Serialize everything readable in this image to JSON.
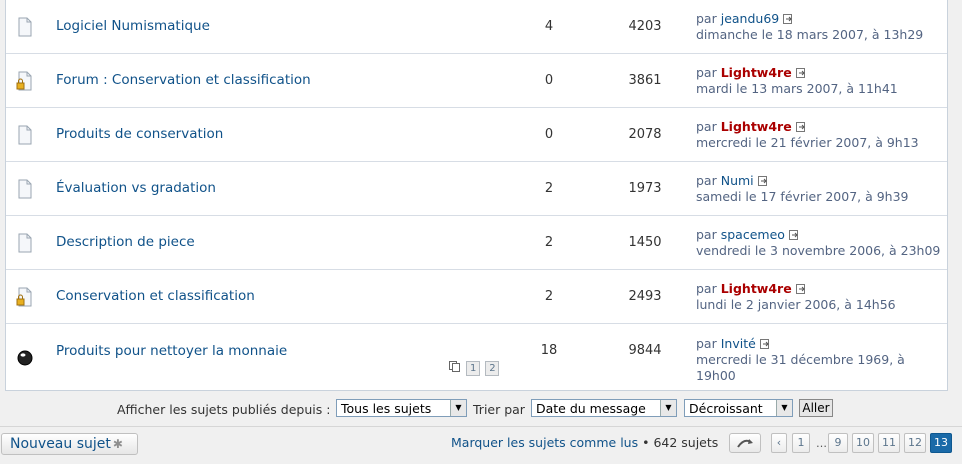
{
  "topics": [
    {
      "title": "Logiciel Numismatique",
      "replies": "4",
      "views": "4203",
      "by": "par ",
      "author": "jeandu69",
      "author_admin": false,
      "date": "dimanche le 18 mars 2007, à 13h29",
      "icon": "topic-read-icon"
    },
    {
      "title": "Forum : Conservation et classification",
      "replies": "0",
      "views": "3861",
      "by": "par ",
      "author": "Lightw4re",
      "author_admin": true,
      "date": "mardi le 13 mars 2007, à 11h41",
      "icon": "topic-locked-icon"
    },
    {
      "title": "Produits de conservation",
      "replies": "0",
      "views": "2078",
      "by": "par ",
      "author": "Lightw4re",
      "author_admin": true,
      "date": "mercredi le 21 février 2007, à 9h13",
      "icon": "topic-read-icon"
    },
    {
      "title": "Évaluation vs gradation",
      "replies": "2",
      "views": "1973",
      "by": "par ",
      "author": "Numi",
      "author_admin": false,
      "date": "samedi le 17 février 2007, à 9h39",
      "icon": "topic-read-icon"
    },
    {
      "title": "Description de piece",
      "replies": "2",
      "views": "1450",
      "by": "par ",
      "author": "spacemeo",
      "author_admin": false,
      "date": "vendredi le 3 novembre 2006, à 23h09",
      "icon": "topic-read-icon"
    },
    {
      "title": "Conservation et classification",
      "replies": "2",
      "views": "2493",
      "by": "par ",
      "author": "Lightw4re",
      "author_admin": true,
      "date": "lundi le 2 janvier 2006, à 14h56",
      "icon": "topic-locked-icon"
    },
    {
      "title": "Produits pour nettoyer la monnaie",
      "replies": "18",
      "views": "9844",
      "by": "par ",
      "author": "Invité",
      "author_admin": false,
      "date_line1": "mercredi le 31 décembre 1969, à",
      "date_line2": "19h00",
      "icon": "topic-global-icon",
      "pages": [
        "1",
        "2"
      ]
    }
  ],
  "filter": {
    "label": "Afficher les sujets publiés depuis :",
    "days_value": "Tous les sujets",
    "sort_label": "Trier par",
    "sort_key_value": "Date du message",
    "sort_dir_value": "Décroissant",
    "go_label": "Aller"
  },
  "bottom": {
    "new_topic_label": "Nouveau sujet",
    "mark_read_label": "Marquer les sujets comme lus",
    "separator": " • ",
    "topic_count": "642 sujets"
  },
  "pagination": {
    "prev": "‹",
    "pages_before": [
      "1"
    ],
    "ellipsis": "…",
    "pages_after": [
      "9",
      "10",
      "11",
      "12"
    ],
    "current": "13"
  },
  "colors": {
    "link": "#105289",
    "admin": "#aa0000",
    "current_page": "#1a6aa8"
  }
}
